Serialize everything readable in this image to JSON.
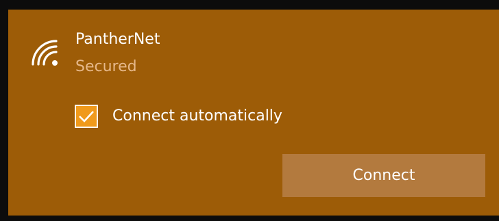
{
  "network": {
    "name": "PantherNet",
    "status": "Secured",
    "signal_icon": "wifi-signal-icon"
  },
  "auto_connect": {
    "label": "Connect automatically",
    "checked": true,
    "check_icon": "checkmark-icon"
  },
  "actions": {
    "connect_label": "Connect"
  },
  "colors": {
    "panel_background": "#9d5c07",
    "checkbox_fill": "#f09a1c",
    "button_background": "#b37a3e",
    "secondary_text": "#e6b88a",
    "frame": "#0c0c0c"
  }
}
